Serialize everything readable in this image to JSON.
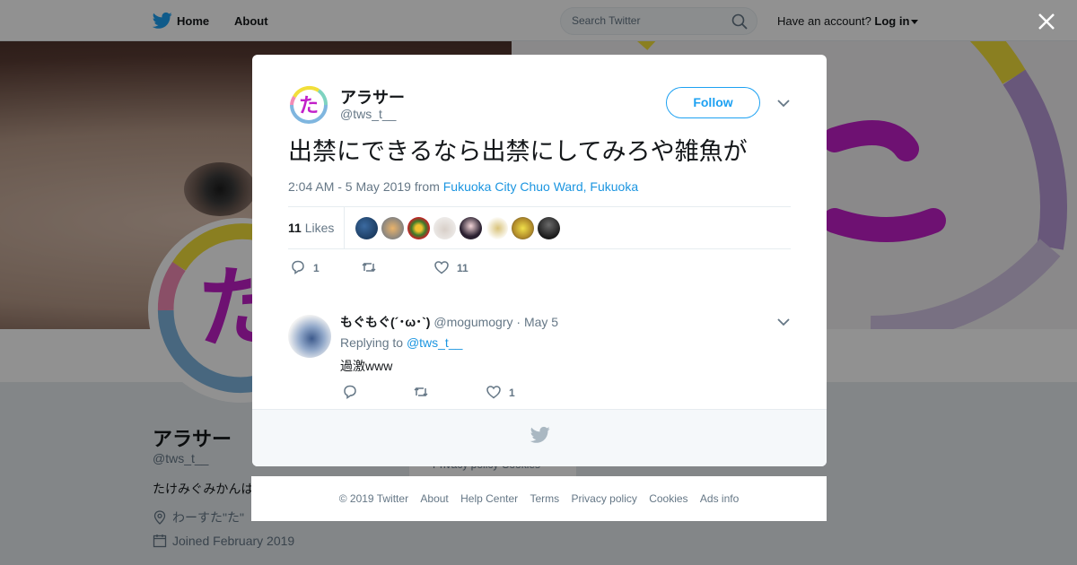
{
  "topnav": {
    "home_label": "Home",
    "about_label": "About",
    "search_placeholder": "Search Twitter",
    "have_account": "Have an account?",
    "login_label": "Log in"
  },
  "profile": {
    "name": "アラサー",
    "handle": "@tws_t__",
    "bio": "たけみぐみかんは",
    "location": "わーすた\"た\"",
    "joined": "Joined February 2019",
    "privacy_links": "Privacy policy  Cookies"
  },
  "tweet": {
    "author_name": "アラサー",
    "author_handle": "@tws_t__",
    "follow_label": "Follow",
    "text": "出禁にできるなら出禁にしてみろや雑魚が",
    "timestamp": "2:04 AM - 5 May 2019 from ",
    "location_link": "Fukuoka City Chuo Ward, Fukuoka",
    "likes_number": "11",
    "likes_label": " Likes",
    "reply_count": "1",
    "retweet_count": "",
    "like_count": "11"
  },
  "reply": {
    "name": "もぐもぐ(´･ω･`)",
    "handle": "@mogumogry",
    "date": "· May 5",
    "replying_prefix": "Replying to ",
    "replying_to": "@tws_t__",
    "text": "過激www",
    "reply_count": "",
    "retweet_count": "",
    "like_count": "1"
  },
  "footer": {
    "copyright": "© 2019 Twitter",
    "about": "About",
    "help": "Help Center",
    "terms": "Terms",
    "privacy": "Privacy policy",
    "cookies": "Cookies",
    "ads": "Ads info"
  },
  "colors": {
    "twitter_blue": "#1da1f2",
    "link_blue": "#1b95e0",
    "avatar_magenta": "#c21fc9",
    "avatar_ring_yellow": "#f2df3a",
    "avatar_ring_teal": "#7ed3c0",
    "avatar_ring_blue": "#7fb6df",
    "avatar_ring_pink": "#f28bb5"
  },
  "icons": [
    "twitter-bird-icon",
    "search-icon",
    "close-icon",
    "chevron-down-icon",
    "reply-icon",
    "retweet-icon",
    "heart-icon",
    "location-icon",
    "calendar-icon"
  ]
}
